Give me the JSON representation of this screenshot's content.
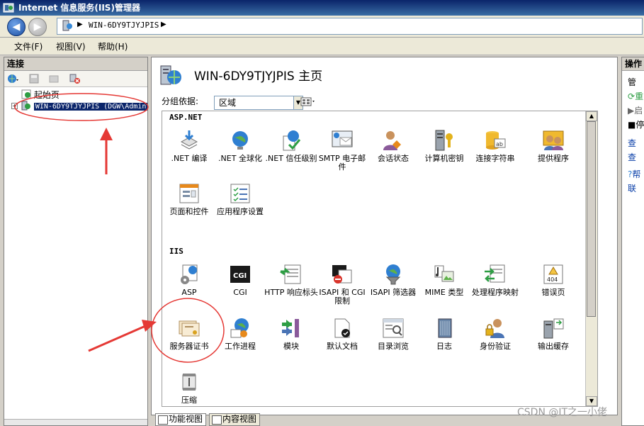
{
  "window": {
    "title": "Internet 信息服务(IIS)管理器"
  },
  "address": {
    "crumb": "WIN-6DY9TJYJPIS"
  },
  "menu": {
    "file": "文件(F)",
    "view": "视图(V)",
    "help": "帮助(H)"
  },
  "connections": {
    "header": "连接",
    "tree": {
      "start_page": "起始页",
      "server": "WIN-6DY9TJYJPIS (DGW\\Admin"
    }
  },
  "main": {
    "title": "WIN-6DY9TJYJPIS 主页",
    "group_by_label": "分组依据:",
    "group_by_value": "区域",
    "sections": {
      "aspnet": {
        "header": "ASP.NET",
        "items": [
          {
            "label": ".NET 编译",
            "icon": "net-compile-icon"
          },
          {
            "label": ".NET 全球化",
            "icon": "globe-icon"
          },
          {
            "label": ".NET 信任级别",
            "icon": "trust-level-icon"
          },
          {
            "label": "SMTP 电子邮件",
            "icon": "smtp-email-icon"
          },
          {
            "label": "会话状态",
            "icon": "session-state-icon"
          },
          {
            "label": "计算机密钥",
            "icon": "machine-key-icon"
          },
          {
            "label": "连接字符串",
            "icon": "connection-string-icon"
          },
          {
            "label": "提供程序",
            "icon": "providers-icon"
          },
          {
            "label": "页面和控件",
            "icon": "pages-controls-icon"
          },
          {
            "label": "应用程序设置",
            "icon": "app-settings-icon"
          }
        ]
      },
      "iis": {
        "header": "IIS",
        "items": [
          {
            "label": "ASP",
            "icon": "asp-icon"
          },
          {
            "label": "CGI",
            "icon": "cgi-icon"
          },
          {
            "label": "HTTP 响应标头",
            "icon": "http-headers-icon"
          },
          {
            "label": "ISAPI 和 CGI 限制",
            "icon": "isapi-cgi-restrictions-icon"
          },
          {
            "label": "ISAPI 筛选器",
            "icon": "isapi-filters-icon"
          },
          {
            "label": "MIME 类型",
            "icon": "mime-types-icon"
          },
          {
            "label": "处理程序映射",
            "icon": "handler-mappings-icon"
          },
          {
            "label": "错误页",
            "icon": "error-pages-icon"
          },
          {
            "label": "服务器证书",
            "icon": "server-certificates-icon"
          },
          {
            "label": "工作进程",
            "icon": "worker-processes-icon"
          },
          {
            "label": "模块",
            "icon": "modules-icon"
          },
          {
            "label": "默认文档",
            "icon": "default-document-icon"
          },
          {
            "label": "目录浏览",
            "icon": "directory-browsing-icon"
          },
          {
            "label": "日志",
            "icon": "logging-icon"
          },
          {
            "label": "身份验证",
            "icon": "authentication-icon"
          },
          {
            "label": "输出缓存",
            "icon": "output-caching-icon"
          },
          {
            "label": "压缩",
            "icon": "compression-icon"
          }
        ]
      }
    },
    "error_page_code": "404"
  },
  "bottom_tabs": {
    "features": "功能视图",
    "content": "内容视图"
  },
  "actions": {
    "header": "操作",
    "items": [
      "管",
      "重",
      "启",
      "停",
      "查",
      "查",
      "帮",
      "联"
    ]
  },
  "watermark": "CSDN @IT之一小佬",
  "colors": {
    "title_bar": "#0a246a",
    "selection": "#0a246a",
    "annotation": "#e53935"
  }
}
